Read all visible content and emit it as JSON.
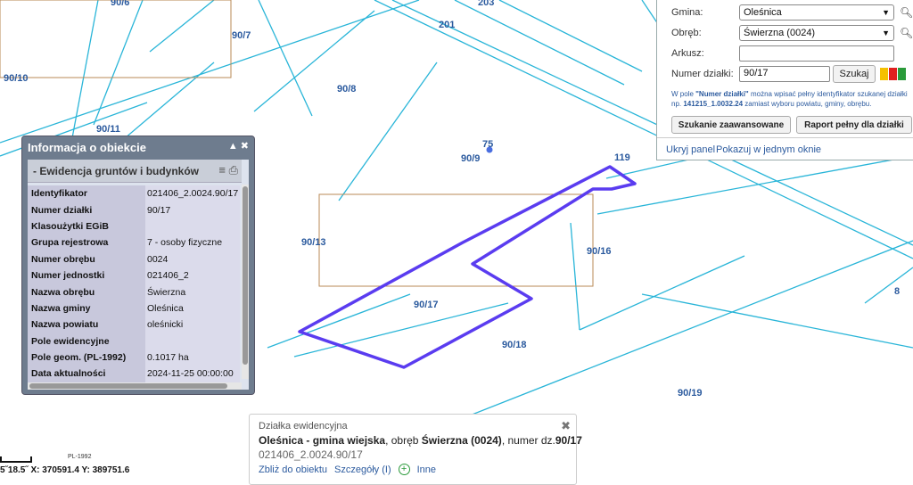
{
  "map": {
    "parcel_labels": [
      "90/6",
      "203",
      "90/7",
      "201",
      "90/10",
      "90/8",
      "90/11",
      "75",
      "90/9",
      "119",
      "90/13",
      "90/16",
      "8",
      "90/17",
      "90/18",
      "90/19"
    ],
    "colors": {
      "parcel_line": "#29b5d8",
      "selected_outline": "#5a3cf0",
      "building_outline": "#b88a55",
      "label": "#2b5a9e"
    }
  },
  "search_panel": {
    "gmina_label": "Gmina:",
    "gmina_value": "Oleśnica",
    "obreb_label": "Obręb:",
    "obreb_value": "Świerzna (0024)",
    "arkusz_label": "Arkusz:",
    "arkusz_value": "",
    "numer_label": "Numer działki:",
    "numer_value": "90/17",
    "search_button": "Szukaj",
    "hint_line1_pre": "W pole ",
    "hint_line1_bold": "\"Numer działki\"",
    "hint_line1_post": " można wpisać pełny identyfikator szukanej działki",
    "hint_line2_pre": "np. ",
    "hint_line2_bold": "141215_1.0032.24",
    "hint_line2_post": " zamiast wyboru powiatu, gminy, obrębu.",
    "advanced_button": "Szukanie zaawansowane",
    "report_button": "Raport pełny dla działki",
    "hide_link": "Ukryj panel",
    "show_link": "Pokazuj w jednym oknie",
    "swatch_colors": [
      "#f5c000",
      "#e02020",
      "#2a9a3a"
    ]
  },
  "info_window": {
    "title": "Informacja o obiekcie",
    "section_title": "Ewidencja gruntów i budynków",
    "rows": [
      {
        "key": "Identyfikator",
        "value": "021406_2.0024.90/17"
      },
      {
        "key": "Numer działki",
        "value": "90/17"
      },
      {
        "key": "Klasoużytki EGiB",
        "value": ""
      },
      {
        "key": "Grupa rejestrowa",
        "value": "7 - osoby fizyczne"
      },
      {
        "key": "Numer obrębu",
        "value": "0024"
      },
      {
        "key": "Numer jednostki",
        "value": "021406_2"
      },
      {
        "key": "Nazwa obrębu",
        "value": "Świerzna"
      },
      {
        "key": "Nazwa gminy",
        "value": "Oleśnica"
      },
      {
        "key": "Nazwa powiatu",
        "value": "oleśnicki"
      },
      {
        "key": "Pole ewidencyjne",
        "value": ""
      },
      {
        "key": "Pole geom. (PL-1992)",
        "value": "0.1017 ha"
      },
      {
        "key": "Data aktualności",
        "value": "2024-11-25 00:00:00"
      }
    ]
  },
  "popup": {
    "header": "Działka ewidencyjna",
    "main_bold1": "Oleśnica - gmina wiejska",
    "main_mid": ", obręb ",
    "main_bold2": "Świerzna (0024)",
    "main_mid2": ", numer dz.",
    "main_bold3": "90/17",
    "id_line": "021406_2.0024.90/17",
    "zoom_link": "Zbliż do obiektu",
    "details_link": "Szczegóły (I)",
    "other_link": "Inne"
  },
  "status": {
    "coords": "5˝18.5˝  X: 370591.4  Y: 389751.6",
    "crs": "PL-1992"
  }
}
